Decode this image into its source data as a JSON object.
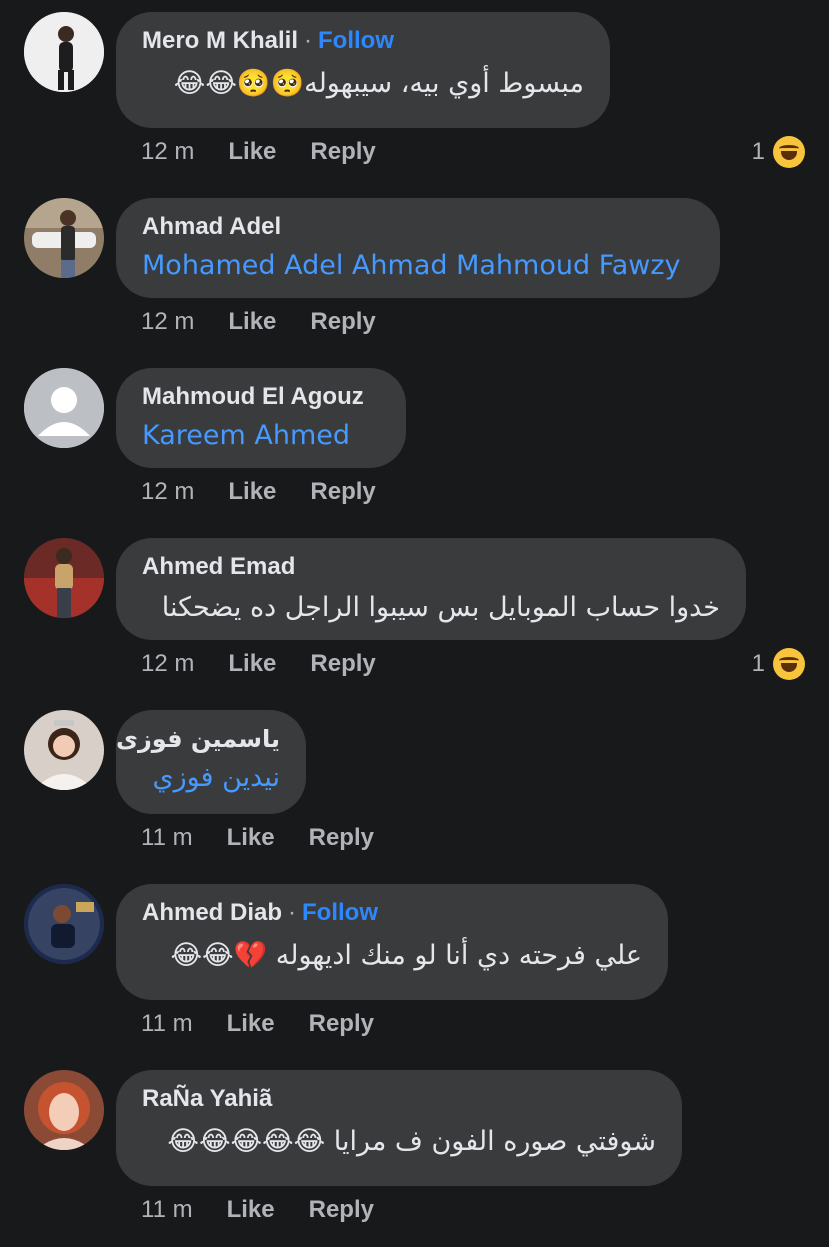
{
  "comments": [
    {
      "name": "Mero M Khalil",
      "follow": "Follow",
      "text": "مبسوط أوي بيه، سيبهوله🥺🥺😂😂",
      "time": "12 m",
      "like": "Like",
      "reply": "Reply",
      "reaction_count": "1",
      "reaction_icon": "haha-reaction-icon"
    },
    {
      "name": "Ahmad Adel",
      "text": "Mohamed Adel  Ahmad Mahmoud Fawzy",
      "time": "12 m",
      "like": "Like",
      "reply": "Reply"
    },
    {
      "name": "Mahmoud El Agouz",
      "text": "Kareem Ahmed",
      "time": "12 m",
      "like": "Like",
      "reply": "Reply"
    },
    {
      "name": "Ahmed Emad",
      "text": "خدوا حساب الموبايل بس سيبوا الراجل ده يضحكنا",
      "time": "12 m",
      "like": "Like",
      "reply": "Reply",
      "reaction_count": "1",
      "reaction_icon": "haha-reaction-icon"
    },
    {
      "name": "ياسمين فوزى",
      "text": "نيدين فوزي",
      "time": "11 m",
      "like": "Like",
      "reply": "Reply"
    },
    {
      "name": "Ahmed Diab",
      "follow": "Follow",
      "text": "علي فرحته دي أنا لو منك اديهوله 💔😂😂",
      "time": "11 m",
      "like": "Like",
      "reply": "Reply"
    },
    {
      "name": "RaÑa Yahiã",
      "text": "شوفتي صوره الفون ف مرايا 😂😂😂😂😂",
      "time": "11 m",
      "like": "Like",
      "reply": "Reply"
    }
  ]
}
